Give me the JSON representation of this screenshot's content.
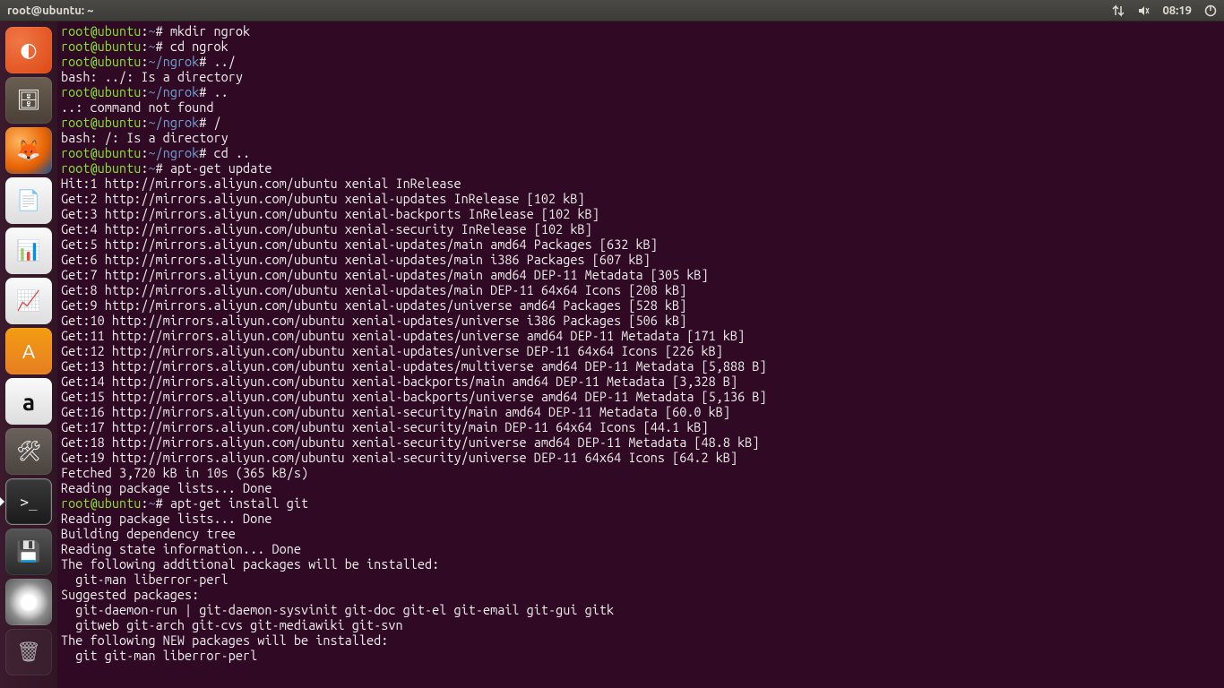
{
  "topbar": {
    "title": "root@ubuntu: ~",
    "time": "08:19"
  },
  "launcher": {
    "items": [
      {
        "name": "ubuntu-dash",
        "glyph": "◐"
      },
      {
        "name": "files",
        "glyph": "🗄"
      },
      {
        "name": "firefox",
        "glyph": "🦊"
      },
      {
        "name": "writer",
        "glyph": "📄"
      },
      {
        "name": "calc",
        "glyph": "📊"
      },
      {
        "name": "impress",
        "glyph": "📈"
      },
      {
        "name": "software",
        "glyph": "A"
      },
      {
        "name": "amazon",
        "glyph": "a"
      },
      {
        "name": "settings",
        "glyph": "🛠"
      },
      {
        "name": "terminal",
        "glyph": ">_"
      },
      {
        "name": "disk",
        "glyph": "💾"
      },
      {
        "name": "dvd",
        "glyph": "◉"
      },
      {
        "name": "trash",
        "glyph": "🗑"
      }
    ]
  },
  "terminal": {
    "prompt_user_host": "root@ubuntu",
    "lines": [
      {
        "type": "prompt",
        "path": "~",
        "sep": "#",
        "cmd": "mkdir ngrok"
      },
      {
        "type": "prompt",
        "path": "~",
        "sep": "#",
        "cmd": "cd ngrok"
      },
      {
        "type": "prompt",
        "path": "~/ngrok",
        "sep": "#",
        "cmd": "../"
      },
      {
        "type": "out",
        "text": "bash: ../: Is a directory"
      },
      {
        "type": "prompt",
        "path": "~/ngrok",
        "sep": "#",
        "cmd": ".."
      },
      {
        "type": "out",
        "text": "..: command not found"
      },
      {
        "type": "prompt",
        "path": "~/ngrok",
        "sep": "#",
        "cmd": "/"
      },
      {
        "type": "out",
        "text": "bash: /: Is a directory"
      },
      {
        "type": "prompt",
        "path": "~/ngrok",
        "sep": "#",
        "cmd": "cd .."
      },
      {
        "type": "prompt",
        "path": "~",
        "sep": "#",
        "cmd": "apt-get update"
      },
      {
        "type": "out",
        "text": "Hit:1 http://mirrors.aliyun.com/ubuntu xenial InRelease"
      },
      {
        "type": "out",
        "text": "Get:2 http://mirrors.aliyun.com/ubuntu xenial-updates InRelease [102 kB]"
      },
      {
        "type": "out",
        "text": "Get:3 http://mirrors.aliyun.com/ubuntu xenial-backports InRelease [102 kB]"
      },
      {
        "type": "out",
        "text": "Get:4 http://mirrors.aliyun.com/ubuntu xenial-security InRelease [102 kB]"
      },
      {
        "type": "out",
        "text": "Get:5 http://mirrors.aliyun.com/ubuntu xenial-updates/main amd64 Packages [632 kB]"
      },
      {
        "type": "out",
        "text": "Get:6 http://mirrors.aliyun.com/ubuntu xenial-updates/main i386 Packages [607 kB]"
      },
      {
        "type": "out",
        "text": "Get:7 http://mirrors.aliyun.com/ubuntu xenial-updates/main amd64 DEP-11 Metadata [305 kB]"
      },
      {
        "type": "out",
        "text": "Get:8 http://mirrors.aliyun.com/ubuntu xenial-updates/main DEP-11 64x64 Icons [208 kB]"
      },
      {
        "type": "out",
        "text": "Get:9 http://mirrors.aliyun.com/ubuntu xenial-updates/universe amd64 Packages [528 kB]"
      },
      {
        "type": "out",
        "text": "Get:10 http://mirrors.aliyun.com/ubuntu xenial-updates/universe i386 Packages [506 kB]"
      },
      {
        "type": "out",
        "text": "Get:11 http://mirrors.aliyun.com/ubuntu xenial-updates/universe amd64 DEP-11 Metadata [171 kB]"
      },
      {
        "type": "out",
        "text": "Get:12 http://mirrors.aliyun.com/ubuntu xenial-updates/universe DEP-11 64x64 Icons [226 kB]"
      },
      {
        "type": "out",
        "text": "Get:13 http://mirrors.aliyun.com/ubuntu xenial-updates/multiverse amd64 DEP-11 Metadata [5,888 B]"
      },
      {
        "type": "out",
        "text": "Get:14 http://mirrors.aliyun.com/ubuntu xenial-backports/main amd64 DEP-11 Metadata [3,328 B]"
      },
      {
        "type": "out",
        "text": "Get:15 http://mirrors.aliyun.com/ubuntu xenial-backports/universe amd64 DEP-11 Metadata [5,136 B]"
      },
      {
        "type": "out",
        "text": "Get:16 http://mirrors.aliyun.com/ubuntu xenial-security/main amd64 DEP-11 Metadata [60.0 kB]"
      },
      {
        "type": "out",
        "text": "Get:17 http://mirrors.aliyun.com/ubuntu xenial-security/main DEP-11 64x64 Icons [44.1 kB]"
      },
      {
        "type": "out",
        "text": "Get:18 http://mirrors.aliyun.com/ubuntu xenial-security/universe amd64 DEP-11 Metadata [48.8 kB]"
      },
      {
        "type": "out",
        "text": "Get:19 http://mirrors.aliyun.com/ubuntu xenial-security/universe DEP-11 64x64 Icons [64.2 kB]"
      },
      {
        "type": "out",
        "text": "Fetched 3,720 kB in 10s (365 kB/s)"
      },
      {
        "type": "out",
        "text": "Reading package lists... Done"
      },
      {
        "type": "prompt",
        "path": "~",
        "sep": "#",
        "cmd": "apt-get install git"
      },
      {
        "type": "out",
        "text": "Reading package lists... Done"
      },
      {
        "type": "out",
        "text": "Building dependency tree"
      },
      {
        "type": "out",
        "text": "Reading state information... Done"
      },
      {
        "type": "out",
        "text": "The following additional packages will be installed:"
      },
      {
        "type": "out",
        "text": "  git-man liberror-perl"
      },
      {
        "type": "out",
        "text": "Suggested packages:"
      },
      {
        "type": "out",
        "text": "  git-daemon-run | git-daemon-sysvinit git-doc git-el git-email git-gui gitk"
      },
      {
        "type": "out",
        "text": "  gitweb git-arch git-cvs git-mediawiki git-svn"
      },
      {
        "type": "out",
        "text": "The following NEW packages will be installed:"
      },
      {
        "type": "out",
        "text": "  git git-man liberror-perl"
      }
    ]
  }
}
